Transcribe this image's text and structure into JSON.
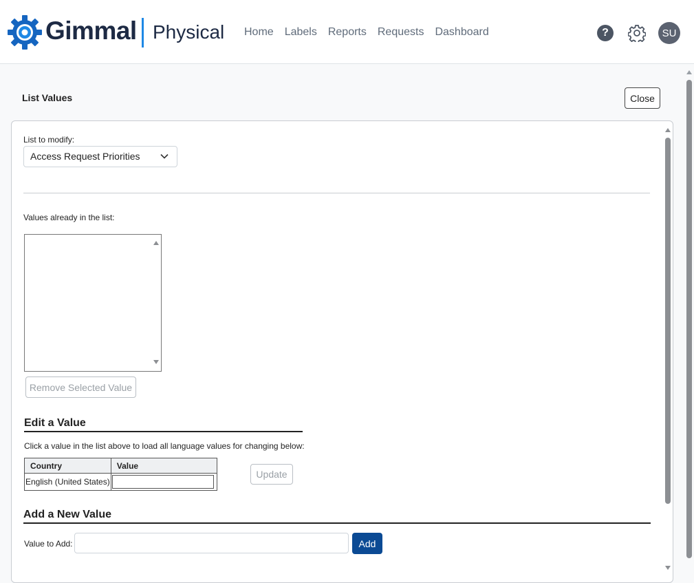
{
  "header": {
    "brand": "Gimmal",
    "product": "Physical",
    "nav": [
      "Home",
      "Labels",
      "Reports",
      "Requests",
      "Dashboard"
    ],
    "help_glyph": "?",
    "settings_icon": "gear-icon",
    "avatar_initials": "SU",
    "brand_color": "#1565c0",
    "accent_color": "#1e88e5"
  },
  "page": {
    "title": "List Values",
    "close_label": "Close"
  },
  "list_modify": {
    "label": "List to modify:",
    "selected": "Access Request Priorities"
  },
  "values_list": {
    "label": "Values already in the list:",
    "items": [],
    "remove_label": "Remove Selected Value"
  },
  "edit_section": {
    "title": "Edit a Value",
    "hint": "Click a value in the list above to load all language values for changing below:",
    "columns": [
      "Country",
      "Value"
    ],
    "rows": [
      {
        "country": "English (United States)",
        "value": ""
      }
    ],
    "update_label": "Update"
  },
  "add_section": {
    "title": "Add a New Value",
    "input_label": "Value to Add:",
    "input_value": "",
    "add_label": "Add",
    "add_color": "#0b4a94"
  }
}
